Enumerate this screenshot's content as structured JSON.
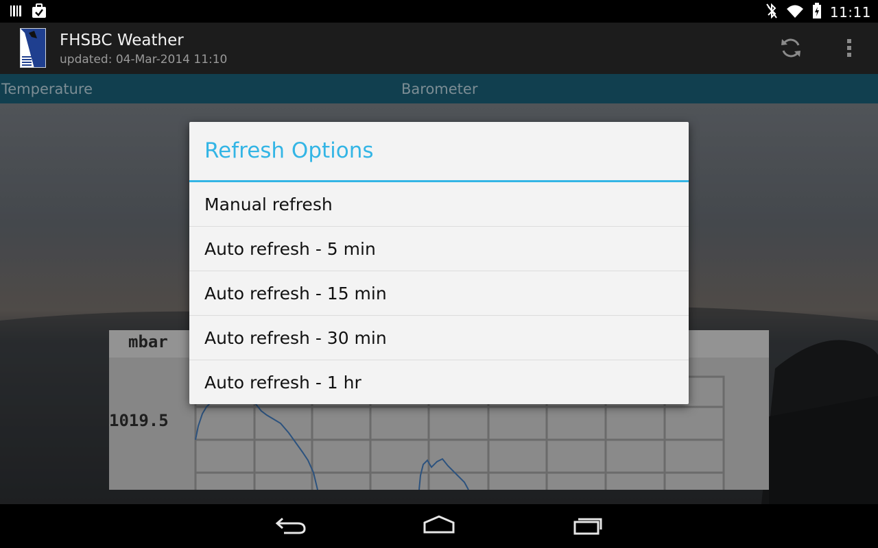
{
  "status_bar": {
    "time": "11:11",
    "left_icons": [
      "barcode-icon",
      "briefcase-check-icon"
    ],
    "right_icons": [
      "bluetooth-off-icon",
      "wifi-icon",
      "battery-icon"
    ]
  },
  "action_bar": {
    "app_title": "FHSBC Weather",
    "subtitle": "updated: 04-Mar-2014 11:10",
    "actions": [
      "refresh-icon",
      "overflow-menu-icon"
    ]
  },
  "tabs": [
    {
      "label": "Temperature"
    },
    {
      "label": "Barometer"
    }
  ],
  "chart_card": {
    "unit_label": "mbar",
    "y_tick_label": "1019.5"
  },
  "dialog": {
    "title": "Refresh Options",
    "options": [
      {
        "label": "Manual refresh"
      },
      {
        "label": "Auto refresh - 5 min"
      },
      {
        "label": "Auto refresh - 15 min"
      },
      {
        "label": "Auto refresh - 30 min"
      },
      {
        "label": "Auto refresh - 1 hr"
      }
    ]
  },
  "colors": {
    "accent": "#33b5e5",
    "tab_strip": "#17546a",
    "action_bar": "#1c1c1c",
    "dialog_bg": "#f3f3f3",
    "chart_line": "#3b6ea8"
  },
  "nav_bar": {
    "buttons": [
      "back-icon",
      "home-icon",
      "recents-icon"
    ]
  }
}
